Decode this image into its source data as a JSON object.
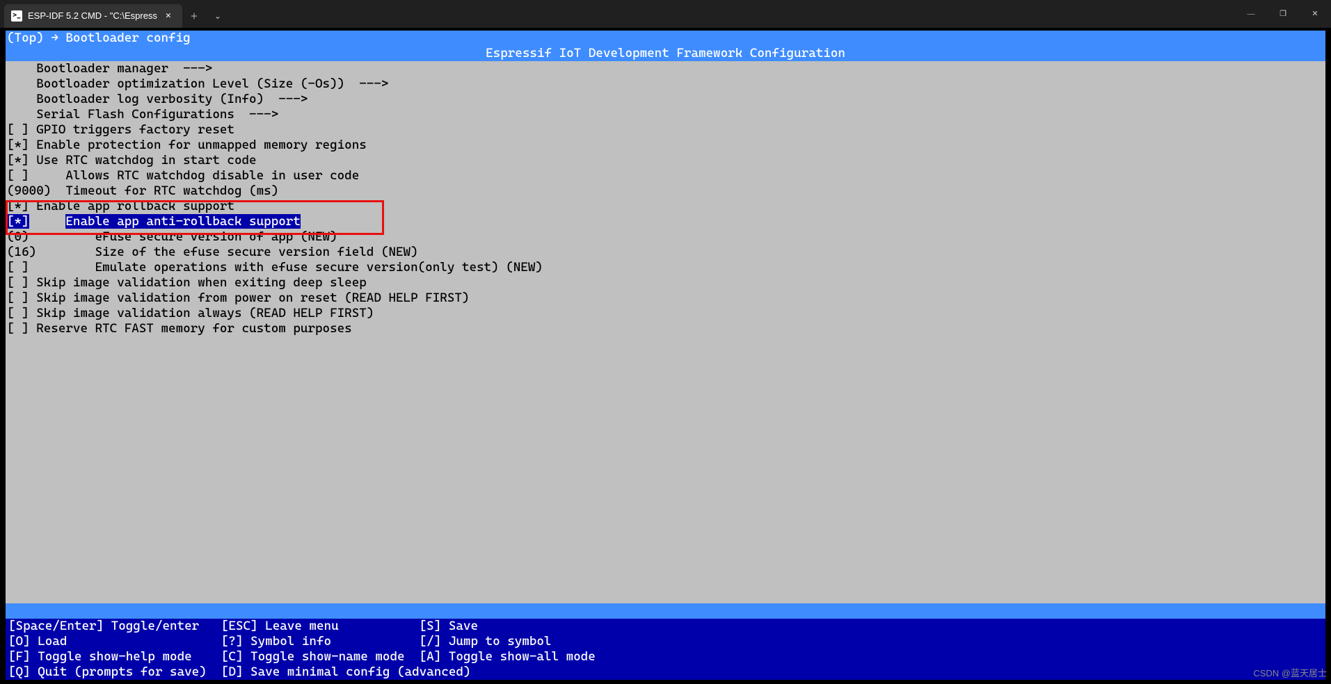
{
  "colors": {
    "bar": "#3f8cff",
    "selected": "#0000aa",
    "term_bg": "#c0c0c0",
    "highlight": "#e81010"
  },
  "titlebar": {
    "tab_title": "ESP-IDF 5.2 CMD - \"C:\\Espress",
    "icon_text": ">_"
  },
  "breadcrumb": "(Top) → Bootloader config",
  "config_title": "Espressif IoT Development Framework Configuration",
  "menu": {
    "items": [
      {
        "indent": "    ",
        "prefix": "",
        "label": "Bootloader manager  --->",
        "selected": false,
        "box": false
      },
      {
        "indent": "    ",
        "prefix": "",
        "label": "Bootloader optimization Level (Size (-Os))  --->",
        "selected": false,
        "box": false
      },
      {
        "indent": "    ",
        "prefix": "",
        "label": "Bootloader log verbosity (Info)  --->",
        "selected": false,
        "box": false
      },
      {
        "indent": "    ",
        "prefix": "",
        "label": "Serial Flash Configurations  --->",
        "selected": false,
        "box": false
      },
      {
        "indent": "",
        "prefix": "[ ] ",
        "label": "GPIO triggers factory reset",
        "selected": false,
        "box": false
      },
      {
        "indent": "",
        "prefix": "[*] ",
        "label": "Enable protection for unmapped memory regions",
        "selected": false,
        "box": false
      },
      {
        "indent": "",
        "prefix": "[*] ",
        "label": "Use RTC watchdog in start code",
        "selected": false,
        "box": false
      },
      {
        "indent": "",
        "prefix": "[ ]     ",
        "label": "Allows RTC watchdog disable in user code",
        "selected": false,
        "box": false
      },
      {
        "indent": "",
        "prefix": "(9000)  ",
        "label": "Timeout for RTC watchdog (ms)",
        "selected": false,
        "box": false
      },
      {
        "indent": "",
        "prefix": "[*] ",
        "label": "Enable app rollback support",
        "selected": false,
        "box": true
      },
      {
        "indent": "",
        "prefix": "[*]     ",
        "label": "Enable app anti-rollback support",
        "selected": true,
        "box": true
      },
      {
        "indent": "",
        "prefix": "(0)         ",
        "label": "eFuse secure version of app (NEW)",
        "selected": false,
        "box": false
      },
      {
        "indent": "",
        "prefix": "(16)        ",
        "label": "Size of the efuse secure version field (NEW)",
        "selected": false,
        "box": false
      },
      {
        "indent": "",
        "prefix": "[ ]         ",
        "label": "Emulate operations with efuse secure version(only test) (NEW)",
        "selected": false,
        "box": false
      },
      {
        "indent": "",
        "prefix": "[ ] ",
        "label": "Skip image validation when exiting deep sleep",
        "selected": false,
        "box": false
      },
      {
        "indent": "",
        "prefix": "[ ] ",
        "label": "Skip image validation from power on reset (READ HELP FIRST)",
        "selected": false,
        "box": false
      },
      {
        "indent": "",
        "prefix": "[ ] ",
        "label": "Skip image validation always (READ HELP FIRST)",
        "selected": false,
        "box": false
      },
      {
        "indent": "",
        "prefix": "[ ] ",
        "label": "Reserve RTC FAST memory for custom purposes",
        "selected": false,
        "box": false
      }
    ]
  },
  "help": {
    "lines": [
      "[Space/Enter] Toggle/enter   [ESC] Leave menu           [S] Save",
      "[O] Load                     [?] Symbol info            [/] Jump to symbol",
      "[F] Toggle show-help mode    [C] Toggle show-name mode  [A] Toggle show-all mode",
      "[Q] Quit (prompts for save)  [D] Save minimal config (advanced)"
    ]
  },
  "watermark": "CSDN @蓝天居士"
}
